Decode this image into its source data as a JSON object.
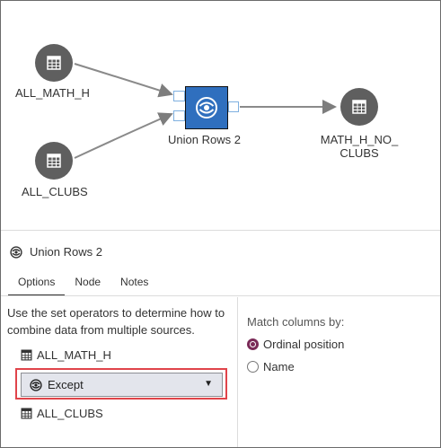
{
  "canvas": {
    "nodes": {
      "all_math_h": "ALL_MATH_H",
      "all_clubs": "ALL_CLUBS",
      "union_rows": "Union Rows 2",
      "output_line1": "MATH_H_NO_",
      "output_line2": "CLUBS"
    }
  },
  "panel": {
    "title": "Union Rows 2",
    "tabs": [
      "Options",
      "Node",
      "Notes"
    ],
    "active_tab": "Options",
    "description": "Use the set operators to determine how to combine data from multiple sources.",
    "sources": {
      "first": "ALL_MATH_H",
      "second": "ALL_CLUBS"
    },
    "operator": {
      "selected": "Except"
    },
    "match_columns": {
      "label": "Match columns by:",
      "options": [
        "Ordinal position",
        "Name"
      ],
      "selected": "Ordinal position"
    }
  },
  "colors": {
    "union_node": "#2f6fbe",
    "highlight": "#e0444a",
    "radio_selected": "#7a2a57",
    "table_node": "#5f5f5f"
  },
  "icons": {
    "table_node": "table-icon",
    "union_node": "union-rows-icon",
    "dropdown": "chevron-down-icon"
  }
}
